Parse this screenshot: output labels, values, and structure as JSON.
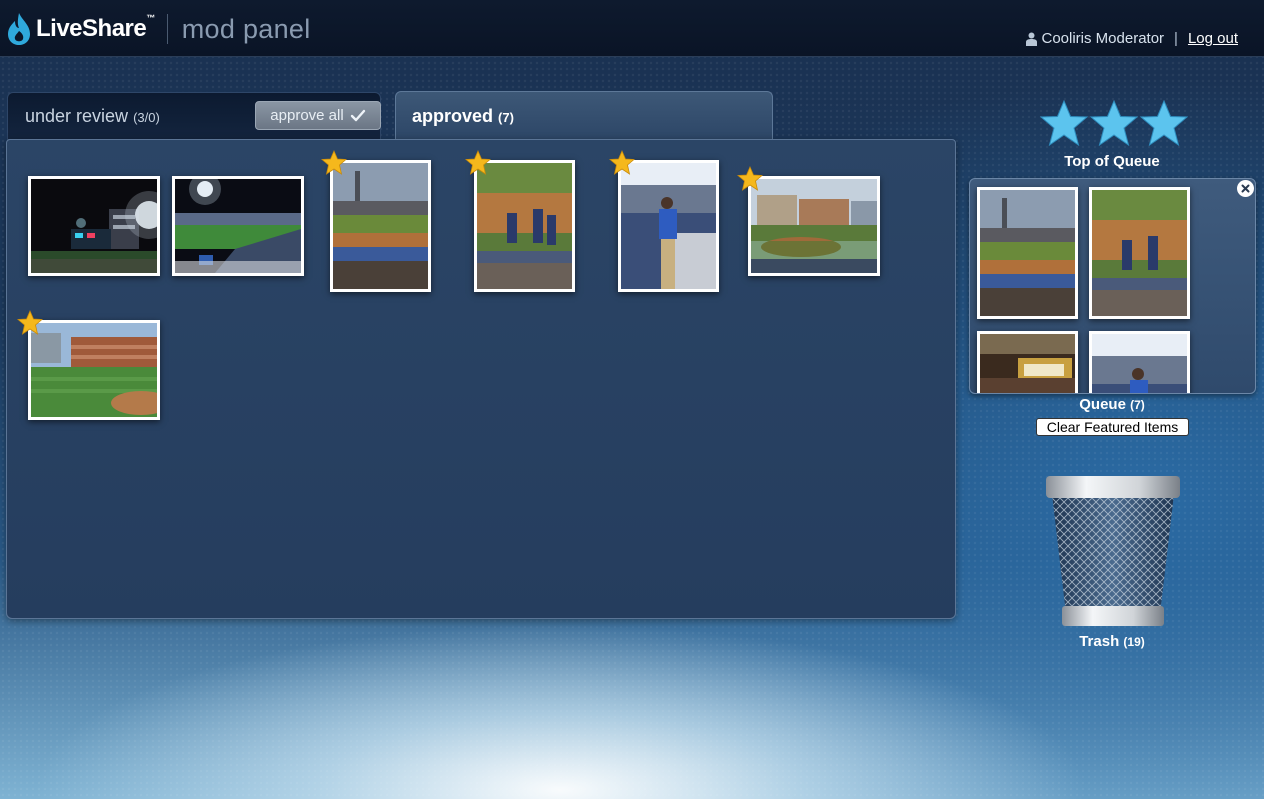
{
  "header": {
    "logo_text": "LiveShare",
    "logo_tm": "™",
    "subtitle": "mod panel",
    "user_icon": "user-icon",
    "user_name": "Cooliris Moderator",
    "separator": "|",
    "logout_label": "Log out"
  },
  "tabs": {
    "under_review": {
      "label": "under review",
      "count": "(3/0)",
      "approve_all_label": "approve all",
      "approve_icon": "checkmark-icon"
    },
    "approved": {
      "label": "approved",
      "count": "(7)"
    }
  },
  "approved_photos": [
    {
      "name": "night stadium fireworks",
      "featured": false
    },
    {
      "name": "night stadium field",
      "featured": false
    },
    {
      "name": "ballpark view with tower",
      "featured": true
    },
    {
      "name": "players on field",
      "featured": true
    },
    {
      "name": "man in blue shirt",
      "featured": true
    },
    {
      "name": "ballpark with buildings",
      "featured": true
    },
    {
      "name": "field and brick buildings",
      "featured": true
    }
  ],
  "queue": {
    "top_label": "Top of Queue",
    "label": "Queue",
    "count": "(7)",
    "clear_label": "Clear Featured Items",
    "close_icon": "close-icon"
  },
  "trash": {
    "label": "Trash",
    "count": "(19)",
    "icon": "trash-can-icon"
  },
  "colors": {
    "accent_star": "#f5b81c",
    "queue_star": "#5cc4ee",
    "panel": "#263f60",
    "header": "#0b1628"
  }
}
